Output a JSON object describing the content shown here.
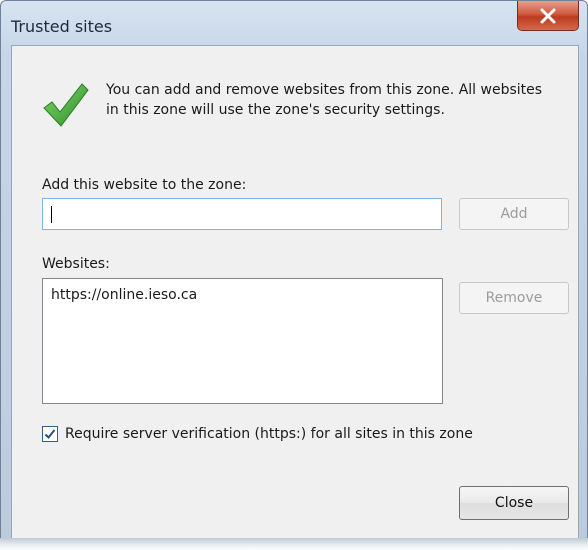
{
  "window": {
    "title": "Trusted sites"
  },
  "intro": {
    "line1": "You can add and remove websites from this zone. All websites",
    "line2": "in this zone will use the zone's security settings."
  },
  "add": {
    "label": "Add this website to the zone:",
    "value": "",
    "placeholder": "",
    "button_label": "Add"
  },
  "websites": {
    "label": "Websites:",
    "items": [
      "https://online.ieso.ca"
    ],
    "remove_label": "Remove"
  },
  "verification": {
    "checked": true,
    "label": "Require server verification (https:) for all sites in this zone"
  },
  "close_label": "Close",
  "icons": {
    "title_close": "close-x-icon",
    "zone": "green-checkmark-icon",
    "checkbox": "checkmark-icon"
  },
  "colors": {
    "close_red": "#c9452a",
    "check_green": "#3aa635",
    "focus_blue": "#7eb4ea"
  }
}
